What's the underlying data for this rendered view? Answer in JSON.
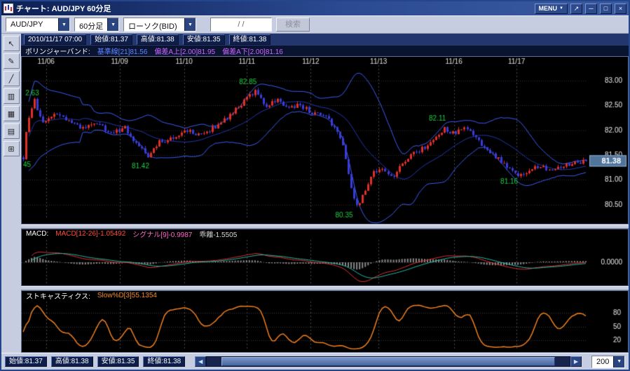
{
  "window": {
    "title": "チャート: AUD/JPY 60分足",
    "menu_label": "MENU"
  },
  "icons": {
    "dropdown_arrow": "▼",
    "menu_arrow": "▼",
    "popout": "↗",
    "minimize": "─",
    "maximize": "□",
    "close": "×",
    "scroll_left": "◀",
    "scroll_right": "▶"
  },
  "toolbar": {
    "pair": "AUD/JPY",
    "timeframe": "60分足",
    "price_type": "ローソク(BID)",
    "date_value": "  /  /",
    "search": "検索"
  },
  "info_bar": {
    "datetime": "2010/11/17 07:00",
    "items": [
      "始値:81.37",
      "高値:81.38",
      "安値:81.35",
      "終値:81.38"
    ]
  },
  "bollinger_bar": {
    "title": "ボリンジャーバンド:",
    "segments": [
      {
        "text": "基準線[21]81.56",
        "color": "#5d86ff"
      },
      {
        "text": "偏差A上[2.00]81.95",
        "color": "#cc66ff"
      },
      {
        "text": "偏差A下[2.00]81.16",
        "color": "#cc66ff"
      }
    ]
  },
  "macd_bar": {
    "title": "MACD:",
    "segments": [
      {
        "text": "MACD[12-26]-1.05492",
        "color": "#ff4a3a"
      },
      {
        "text": "シグナル[9]-0.9987",
        "color": "#ff66cc"
      },
      {
        "text": "乖離-1.5505",
        "color": "#d8d8d8"
      }
    ]
  },
  "stoch_bar": {
    "title": "ストキャスティクス:",
    "segments": [
      {
        "text": "Slow%D[3]55.1354",
        "color": "#f08a20"
      }
    ]
  },
  "sidebar": {
    "tools": [
      {
        "name": "select-tool",
        "glyph": "↖"
      },
      {
        "name": "pencil-tool",
        "glyph": "✎"
      },
      {
        "name": "line-tool",
        "glyph": "╱"
      },
      {
        "name": "candlestick-tool",
        "glyph": "▥"
      },
      {
        "name": "grid-tool",
        "glyph": "▦"
      },
      {
        "name": "print-tool",
        "glyph": "▤"
      },
      {
        "name": "settings-tool",
        "glyph": "⊞"
      }
    ]
  },
  "status_bar": {
    "items": [
      "始値:81.37",
      "高値:81.38",
      "安値:81.35",
      "終値:81.38"
    ],
    "bars_count": "200"
  },
  "chart_data": [
    {
      "type": "candlestick",
      "symbol": "AUD/JPY",
      "timeframe": "60分足",
      "candle_count": 200,
      "x_labels": [
        {
          "text": "11/06",
          "pos": 0.043
        },
        {
          "text": "11/09",
          "pos": 0.173
        },
        {
          "text": "11/10",
          "pos": 0.287
        },
        {
          "text": "11/11",
          "pos": 0.398
        },
        {
          "text": "11/12",
          "pos": 0.511
        },
        {
          "text": "11/13",
          "pos": 0.631
        },
        {
          "text": "11/16",
          "pos": 0.764
        },
        {
          "text": "11/17",
          "pos": 0.875
        }
      ],
      "y_ticks": [
        "83.00",
        "82.50",
        "82.00",
        "81.50",
        "81.00",
        "80.50"
      ],
      "y_tick_values": [
        83.0,
        82.5,
        82.0,
        81.5,
        81.0,
        80.5
      ],
      "y_range": [
        80.2,
        83.25
      ],
      "current_price": "81.38",
      "current_price_value": 81.38,
      "annotations": [
        {
          "text": "2.63",
          "pos": 0.004,
          "price": 82.74,
          "align": "left"
        },
        {
          "text": "45",
          "pos": 0.0,
          "price": 81.3,
          "align": "left"
        },
        {
          "text": "81.42",
          "pos": 0.21,
          "price": 81.28
        },
        {
          "text": "82.85",
          "pos": 0.4,
          "price": 82.97
        },
        {
          "text": "80.35",
          "pos": 0.57,
          "price": 80.28
        },
        {
          "text": "82.11",
          "pos": 0.735,
          "price": 82.23
        },
        {
          "text": "81.16",
          "pos": 0.862,
          "price": 80.96
        }
      ],
      "bollinger": {
        "period": 21,
        "deviation": 2.0
      },
      "colors": {
        "up": "#e03028",
        "down": "#3a3cd8",
        "band": "#3d5df5",
        "mid": "#2238b0",
        "annotation": "#22cc44",
        "price_badge": "#51749b"
      },
      "path": [
        [
          0.0,
          81.45
        ],
        [
          0.008,
          82.2
        ],
        [
          0.019,
          82.62
        ],
        [
          0.034,
          82.1
        ],
        [
          0.056,
          82.35
        ],
        [
          0.08,
          82.18
        ],
        [
          0.105,
          82.02
        ],
        [
          0.13,
          82.15
        ],
        [
          0.155,
          81.92
        ],
        [
          0.18,
          82.06
        ],
        [
          0.204,
          81.7
        ],
        [
          0.222,
          81.45
        ],
        [
          0.24,
          81.75
        ],
        [
          0.266,
          81.86
        ],
        [
          0.29,
          82.0
        ],
        [
          0.315,
          81.88
        ],
        [
          0.34,
          82.06
        ],
        [
          0.365,
          82.28
        ],
        [
          0.39,
          82.55
        ],
        [
          0.413,
          82.8
        ],
        [
          0.432,
          82.48
        ],
        [
          0.451,
          82.62
        ],
        [
          0.47,
          82.42
        ],
        [
          0.489,
          82.52
        ],
        [
          0.513,
          82.35
        ],
        [
          0.537,
          82.28
        ],
        [
          0.556,
          82.0
        ],
        [
          0.57,
          81.6
        ],
        [
          0.582,
          80.9
        ],
        [
          0.593,
          80.45
        ],
        [
          0.606,
          80.72
        ],
        [
          0.619,
          81.1
        ],
        [
          0.637,
          81.25
        ],
        [
          0.655,
          81.05
        ],
        [
          0.674,
          81.32
        ],
        [
          0.693,
          81.52
        ],
        [
          0.712,
          81.65
        ],
        [
          0.73,
          81.8
        ],
        [
          0.748,
          82.02
        ],
        [
          0.766,
          81.93
        ],
        [
          0.785,
          82.04
        ],
        [
          0.804,
          81.86
        ],
        [
          0.822,
          81.6
        ],
        [
          0.841,
          81.46
        ],
        [
          0.86,
          81.26
        ],
        [
          0.878,
          81.06
        ],
        [
          0.897,
          81.18
        ],
        [
          0.915,
          81.28
        ],
        [
          0.934,
          81.22
        ],
        [
          0.953,
          81.28
        ],
        [
          0.976,
          81.33
        ],
        [
          1.0,
          81.38
        ]
      ]
    },
    {
      "type": "macd-histogram",
      "params": "MACD[12-26] シグナル[9]",
      "y_axis_label": "0.0000",
      "colors": {
        "macd": "#e03030",
        "signal": "#2ab8a8",
        "histogram": "#8a8a8a"
      }
    },
    {
      "type": "stochastic",
      "params": "Slow%D[3]",
      "y_ticks": [
        "80",
        "50",
        "20"
      ],
      "y_tick_values": [
        80,
        50,
        20
      ],
      "color": "#f08020"
    }
  ]
}
